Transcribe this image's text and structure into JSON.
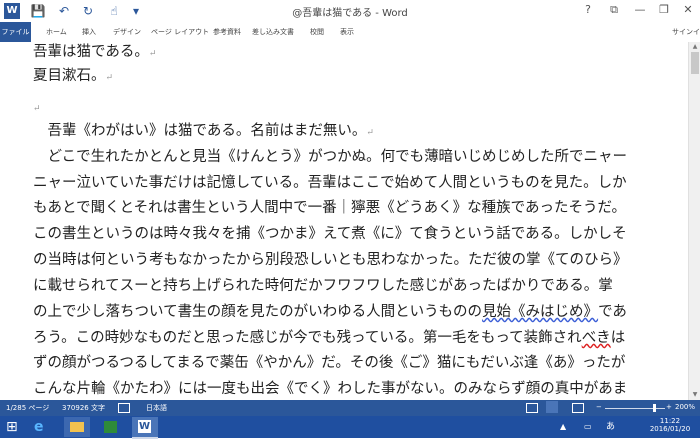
{
  "window": {
    "title": "@吾輩は猫である - Word",
    "help_glyph": "?",
    "minimize_glyph": "—",
    "restore_glyph": "❐",
    "close_glyph": "✕"
  },
  "quick_access": {
    "word_icon_glyph": "W",
    "save_glyph": "💾",
    "undo_glyph": "↶",
    "redo_glyph": "↻",
    "touch_glyph": "☝",
    "customize_glyph": "▾"
  },
  "ribbon": {
    "tabs": [
      "ファイル",
      "ホーム",
      "挿入",
      "デザイン",
      "ページ レイアウト",
      "参考資料",
      "差し込み文書",
      "校閲",
      "表示"
    ],
    "signin": "サインイン"
  },
  "document": {
    "lines": [
      {
        "text": "吾輩は猫である。"
      },
      {
        "text": "夏目漱石。"
      },
      {
        "text": ""
      },
      {
        "text": "　吾輩《わがはい》は猫である。名前はまだ無い。"
      },
      {
        "text": "　どこで生れたかとんと見当《けんとう》がつかぬ。何でも薄暗いじめじめした所でニャー"
      },
      {
        "text": "ニャー泣いていた事だけは記憶している。吾輩はここで始めて人間というものを見た。しか"
      },
      {
        "text": "もあとで聞くとそれは書生という人間中で一番｜獰悪《どうあく》な種族であったそうだ。"
      },
      {
        "text": "この書生というのは時々我々を捕《つかま》えて煮《に》て食うという話である。しかしそ"
      },
      {
        "text": "の当時は何という考もなかったから別段恐しいとも思わなかった。ただ彼の掌《てのひら》"
      },
      {
        "text": "に載せられてスーと持ち上げられた時何だかフワフワした感じがあったばかりである。掌"
      },
      {
        "text": "の上で少し落ちついて書生の顔を見たのがいわゆる人間というものの見始《みはじめ》であ"
      },
      {
        "text": "ろう。この時妙なものだと思った感じが今でも残っている。第一毛をもって装飾されべきは"
      },
      {
        "text": "ずの顔がつるつるしてまるで薬缶《やかん》だ。その後《ご》猫にもだいぶ逢《あ》ったが"
      },
      {
        "text": "こんな片輪《かたわ》には一度も出会《でく》わした事がない。のみならず顔の真中があま"
      }
    ],
    "paragraph_mark": "↵",
    "wavy_blue_text": "見始《みはじめ》",
    "wavy_red_text": "べき"
  },
  "status_bar": {
    "page": "1/285 ページ",
    "words": "370926 文字",
    "language": "日本語",
    "zoom": "200%",
    "zoom_level": 0.82
  },
  "taskbar": {
    "clock_time": "11:22",
    "clock_date": "2016/01/20",
    "start_glyph": "⊞",
    "ime_glyph": "あ",
    "app_word_glyph": "W"
  },
  "colors": {
    "word_blue": "#2b579a",
    "taskbar_blue": "#1f4fa0"
  },
  "icons": [
    "word-app-icon",
    "save-icon",
    "undo-icon",
    "redo-icon",
    "touch-mode-icon",
    "customize-icon",
    "help-icon",
    "ribbon-display-icon",
    "minimize-icon",
    "restore-icon",
    "close-icon",
    "macro-icon",
    "read-mode-icon",
    "print-layout-icon",
    "web-layout-icon",
    "start-icon",
    "ie-icon",
    "explorer-icon",
    "store-icon",
    "word-taskbar-icon",
    "notification-icon"
  ]
}
